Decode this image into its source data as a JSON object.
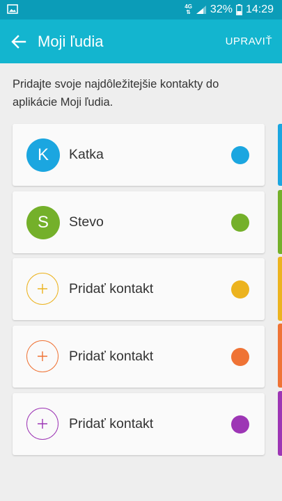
{
  "status_bar": {
    "network": "4G",
    "battery": "32%",
    "time": "14:29"
  },
  "header": {
    "title": "Moji ľudia",
    "edit_label": "UPRAVIŤ"
  },
  "description": "Pridajte svoje najdôležitejšie kontakty do aplikácie Moji ľudia.",
  "contacts": [
    {
      "initial": "K",
      "name": "Katka",
      "color": "#1ba6e0"
    },
    {
      "initial": "S",
      "name": "Stevo",
      "color": "#74b02a"
    },
    {
      "label": "Pridať kontakt",
      "color": "#ecb31f"
    },
    {
      "label": "Pridať kontakt",
      "color": "#ef7335"
    },
    {
      "label": "Pridať kontakt",
      "color": "#9d36b5"
    }
  ],
  "icons": {
    "status_left": "image-icon",
    "signal": "signal-icon",
    "battery": "battery-icon",
    "back": "arrow-left-icon",
    "add": "plus-icon"
  }
}
